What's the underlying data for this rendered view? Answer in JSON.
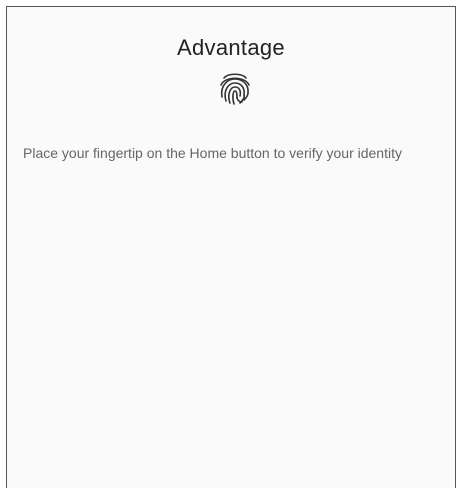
{
  "dialog": {
    "title": "Advantage",
    "icon": "fingerprint-icon",
    "message": "Place your fingertip on the Home button to verify your identity"
  }
}
